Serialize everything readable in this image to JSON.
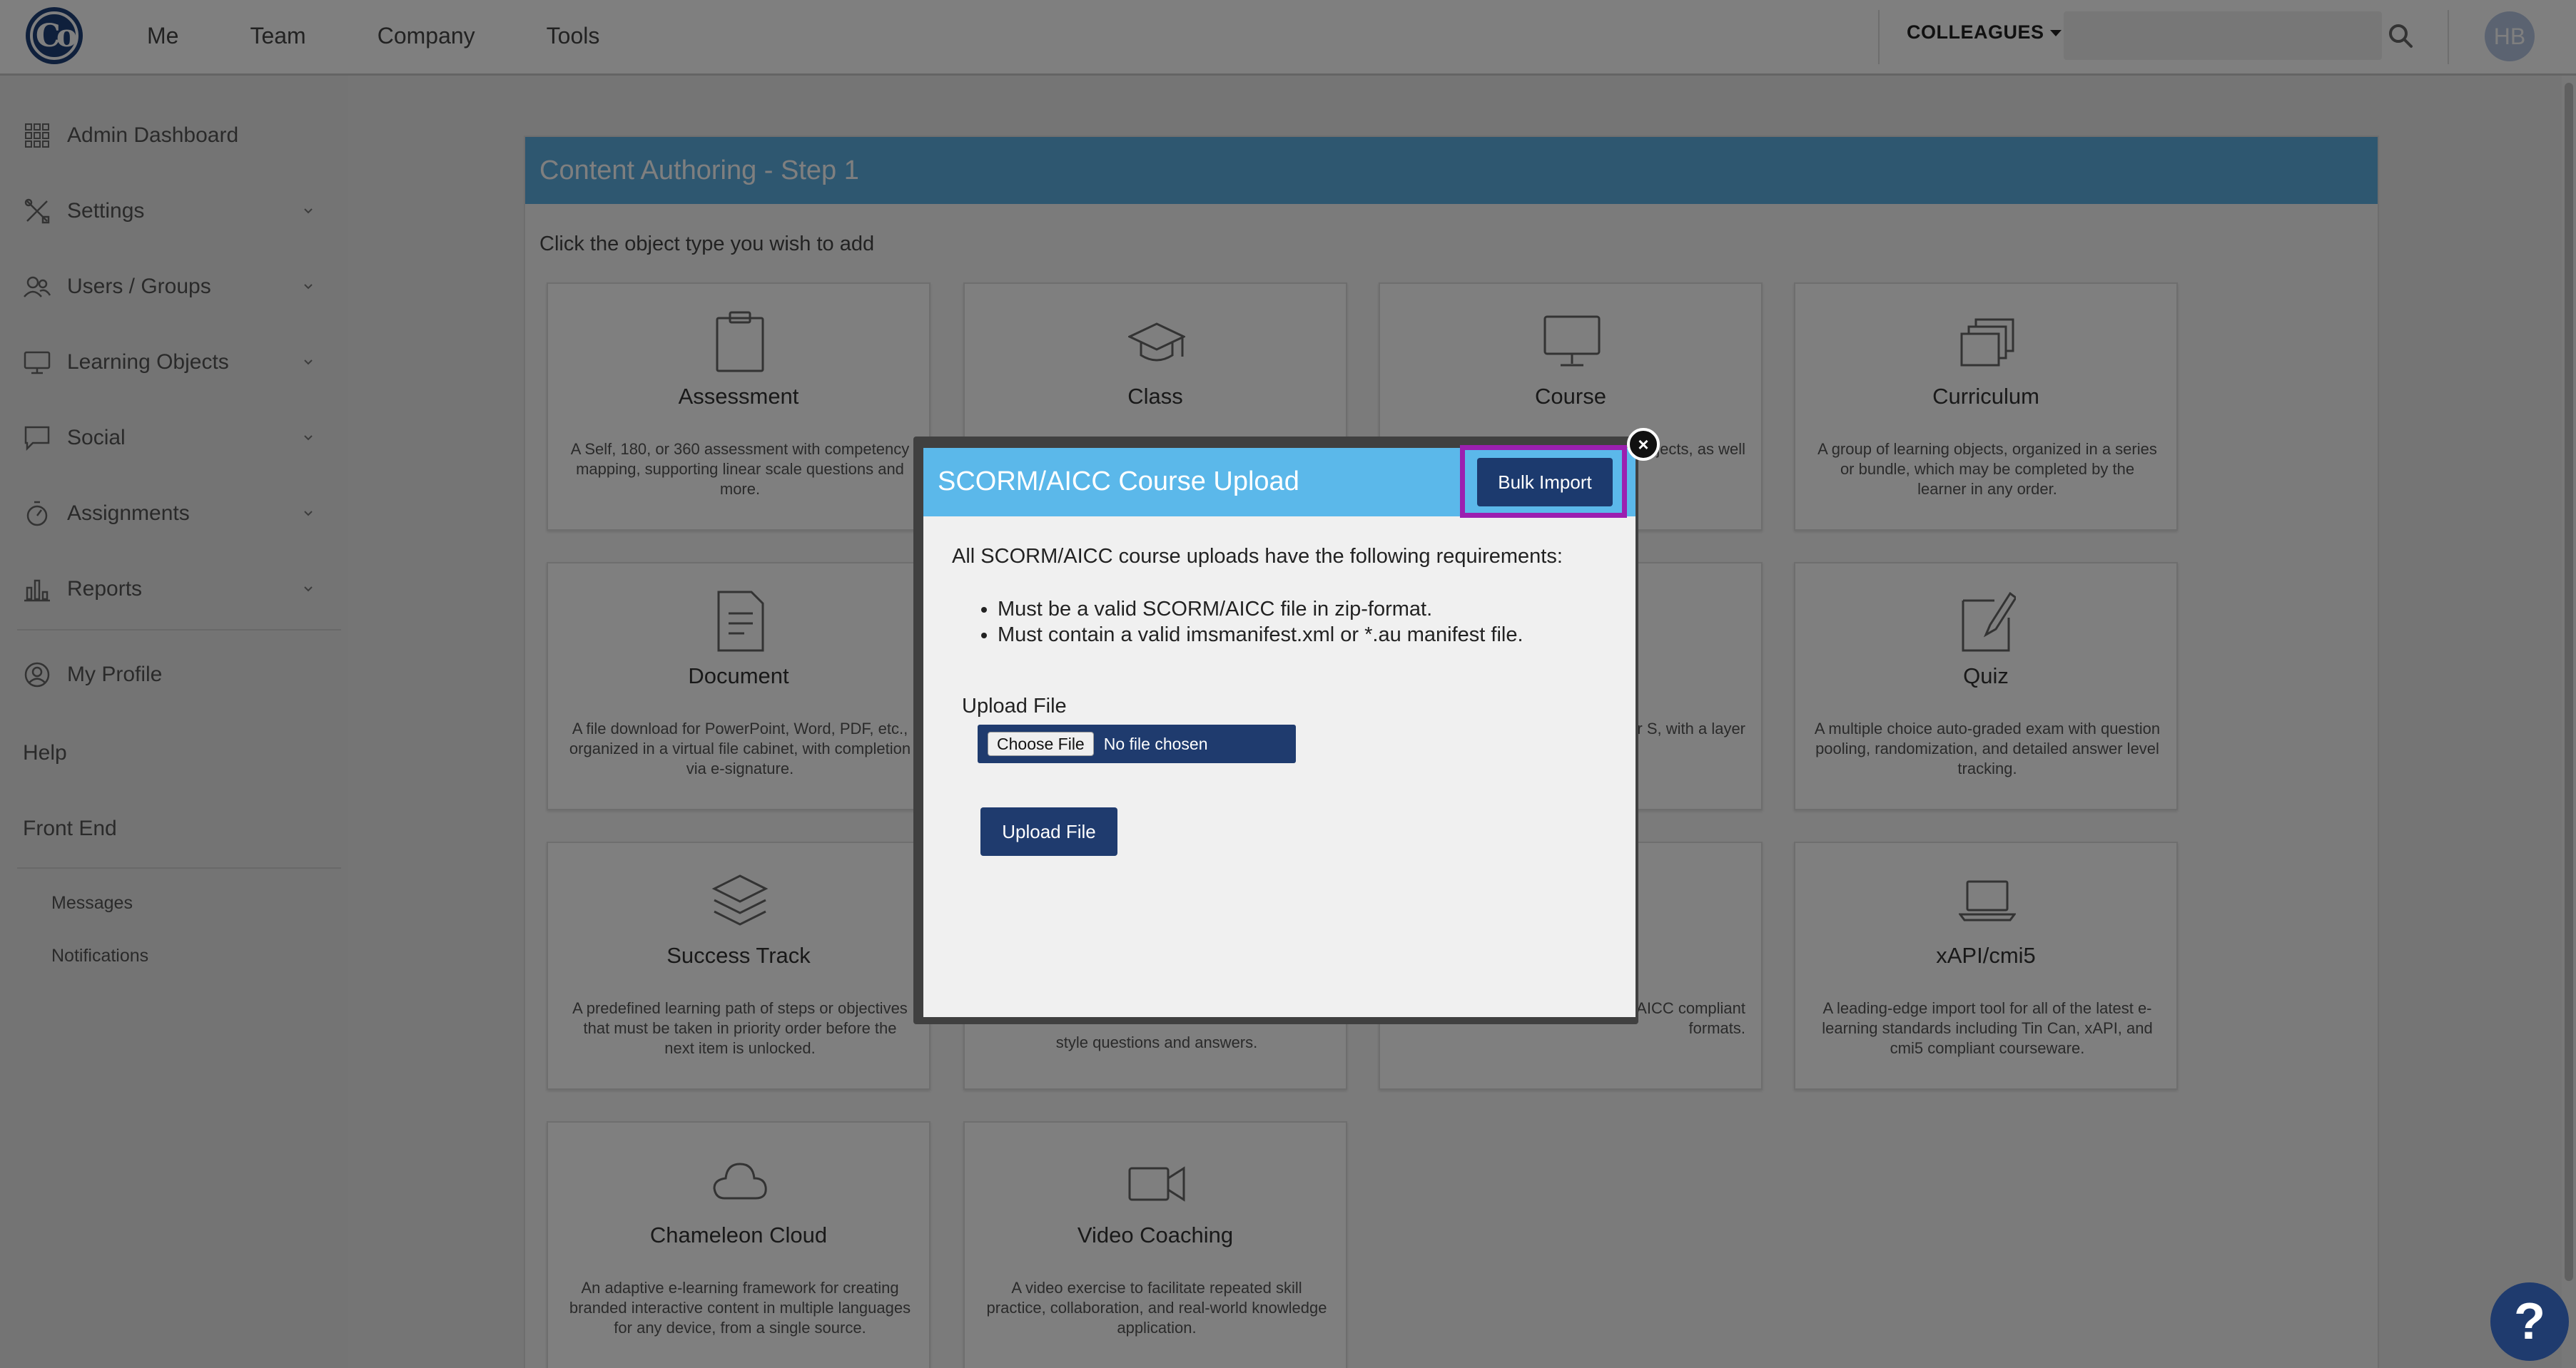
{
  "topbar": {
    "nav": [
      "Me",
      "Team",
      "Company",
      "Tools"
    ],
    "colleagues_label": "COLLEAGUES",
    "search_placeholder": "",
    "avatar_initials": "HB"
  },
  "sidebar": {
    "items": [
      {
        "label": "Admin Dashboard",
        "icon": "grid-icon",
        "expandable": false
      },
      {
        "label": "Settings",
        "icon": "tools-icon",
        "expandable": true
      },
      {
        "label": "Users / Groups",
        "icon": "users-icon",
        "expandable": true
      },
      {
        "label": "Learning Objects",
        "icon": "monitor-icon",
        "expandable": true
      },
      {
        "label": "Social",
        "icon": "chat-icon",
        "expandable": true
      },
      {
        "label": "Assignments",
        "icon": "stopwatch-icon",
        "expandable": true
      },
      {
        "label": "Reports",
        "icon": "bar-chart-icon",
        "expandable": true
      }
    ],
    "my_profile": "My Profile",
    "help": "Help",
    "front_end": "Front End",
    "messages": "Messages",
    "notifications": "Notifications"
  },
  "panel": {
    "title": "Content Authoring - Step 1",
    "subtitle": "Click the object type you wish to add",
    "cards": [
      {
        "title": "Assessment",
        "icon": "clipboard-icon",
        "desc": "A Self, 180, or 360 assessment with competency mapping, supporting linear scale questions and more."
      },
      {
        "title": "Class",
        "icon": "graduation-cap-icon",
        "desc": ""
      },
      {
        "title": "Course",
        "icon": "monitor-icon",
        "desc": "core steps jects, as well"
      },
      {
        "title": "Curriculum",
        "icon": "stack-icon",
        "desc": "A group of learning objects, organized in a series or bundle, which may be completed by the learner in any order."
      },
      {
        "title": "Document",
        "icon": "document-icon",
        "desc": "A file download for PowerPoint, Word, PDF, etc., organized in a virtual file cabinet, with completion via e-signature."
      },
      {
        "title": "",
        "icon": "",
        "desc": ""
      },
      {
        "title": "",
        "icon": "",
        "desc": "anet URL's or S, with a layer"
      },
      {
        "title": "Quiz",
        "icon": "pencil-icon",
        "desc": "A multiple choice auto-graded exam with question pooling, randomization, and detailed answer level tracking."
      },
      {
        "title": "Success Track",
        "icon": "layers-icon",
        "desc": "A predefined learning path of steps or objectives that must be taken in priority order before the next item is unlocked."
      },
      {
        "title": "",
        "icon": "",
        "desc": "style questions and answers."
      },
      {
        "title": "",
        "icon": "",
        "desc": "y industry veloped in SCORM or AICC compliant formats."
      },
      {
        "title": "xAPI/cmi5",
        "icon": "laptop-icon",
        "desc": "A leading-edge import tool for all of the latest e-learning standards including Tin Can, xAPI, and cmi5 compliant courseware."
      },
      {
        "title": "Chameleon Cloud",
        "icon": "cloud-icon",
        "desc": "An adaptive e-learning framework for creating branded interactive content in multiple languages for any device, from a single source."
      },
      {
        "title": "Video Coaching",
        "icon": "video-camera-icon",
        "desc": "A video exercise to facilitate repeated skill practice, collaboration, and real-world knowledge application."
      }
    ]
  },
  "modal": {
    "title": "SCORM/AICC Course Upload",
    "bulk_import": "Bulk Import",
    "requirements_intro": "All SCORM/AICC course uploads have the following requirements:",
    "requirements": [
      "Must be a valid SCORM/AICC file in zip-format.",
      "Must contain a valid imsmanifest.xml or *.au manifest file."
    ],
    "upload_label": "Upload File",
    "choose_file": "Choose File",
    "no_file": "No file chosen",
    "upload_button": "Upload File",
    "close": "×"
  },
  "help_bubble": "?",
  "colors": {
    "brand": "#1f3b6e",
    "header_blue": "#5dafe0",
    "modal_header": "#5bb8ea",
    "highlight": "#9b1fb0"
  }
}
